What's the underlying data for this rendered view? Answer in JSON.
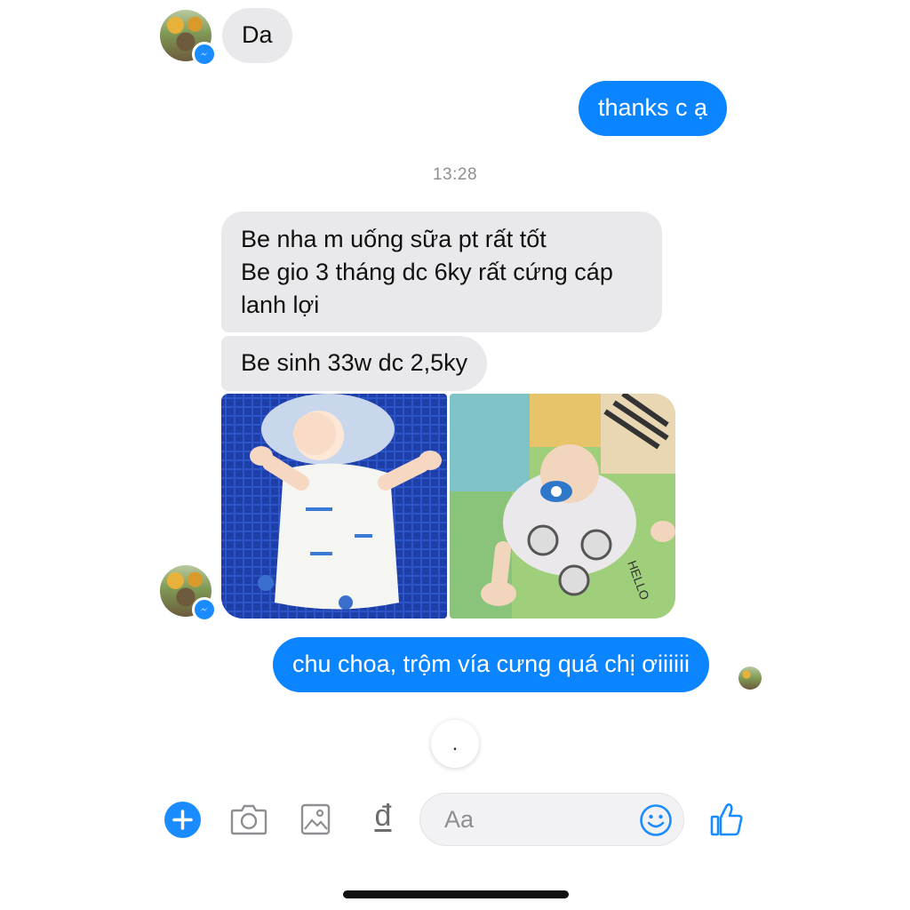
{
  "conversation": {
    "messages": [
      {
        "from": "them",
        "text": "Da"
      },
      {
        "from": "me",
        "text": "thanks c ạ"
      },
      {
        "type": "timestamp",
        "text": "13:28"
      },
      {
        "from": "them",
        "lines": [
          "Be nha m uống sữa pt rất tốt",
          "Be gio 3 tháng dc 6ky rất cứng cáp",
          "lanh lợi"
        ]
      },
      {
        "from": "them",
        "text": "Be sinh 33w dc 2,5ky"
      },
      {
        "from": "them",
        "type": "photos",
        "photos": [
          {
            "description_icon": "baby-photo-blue-background"
          },
          {
            "description_icon": "baby-photo-playmat-background",
            "shirt_text": "HELLO"
          }
        ]
      },
      {
        "from": "me",
        "text": "chu choa, trộm vía cưng quá chị ơiiiiii"
      }
    ],
    "typing_indicator": "."
  },
  "composer": {
    "placeholder": "Aa",
    "dong_symbol": "đ"
  },
  "colors": {
    "outgoing_bubble": "#0a84ff",
    "incoming_bubble": "#e9e9eb",
    "accent": "#1a8cff"
  },
  "icons": [
    "add-icon",
    "camera-icon",
    "image-icon",
    "dong-currency-icon",
    "emoji-icon",
    "thumbs-up-icon",
    "messenger-badge-icon"
  ]
}
